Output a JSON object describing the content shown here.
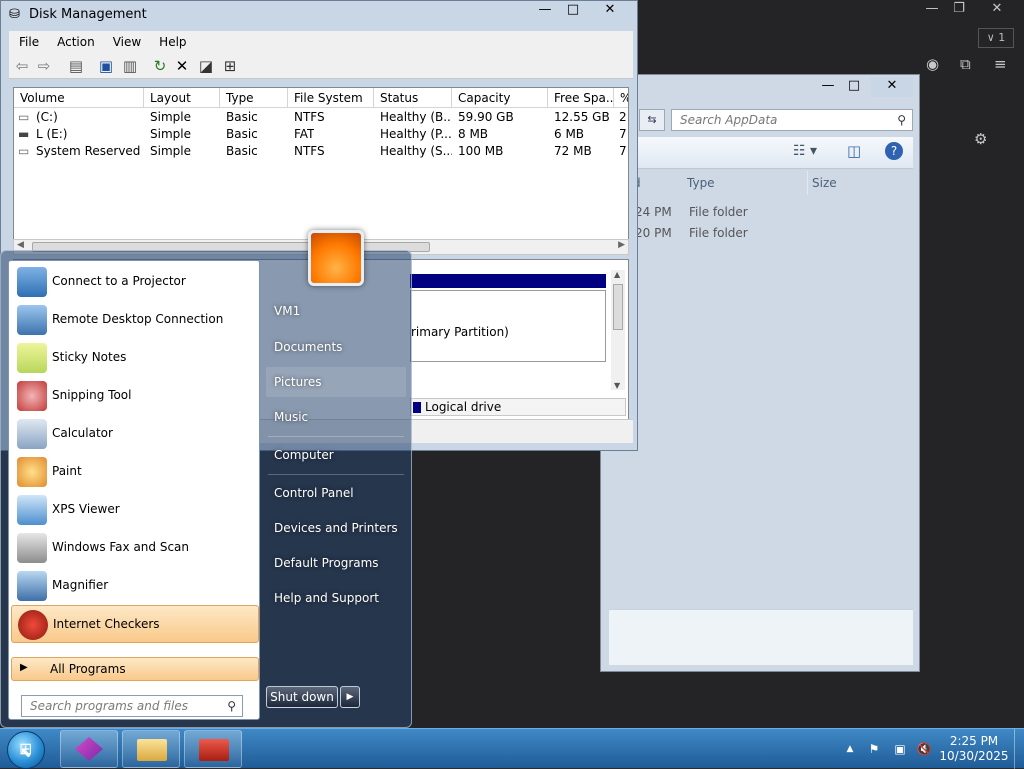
{
  "background_app": {
    "tab_counter": "1"
  },
  "explorer": {
    "search_placeholder": "Search AppData",
    "columns": [
      "Type",
      "Size"
    ],
    "rows": [
      {
        "date_fragment": "24 PM",
        "type": "File folder"
      },
      {
        "date_fragment": "20 PM",
        "type": "File folder"
      }
    ],
    "col_fragment": "d"
  },
  "disk_management": {
    "title": "Disk Management",
    "menu": [
      "File",
      "Action",
      "View",
      "Help"
    ],
    "columns": [
      "Volume",
      "Layout",
      "Type",
      "File System",
      "Status",
      "Capacity",
      "Free Spa...",
      "%"
    ],
    "volumes": [
      {
        "volume": "(C:)",
        "layout": "Simple",
        "type": "Basic",
        "fs": "NTFS",
        "status": "Healthy (B...",
        "capacity": "59.90 GB",
        "free": "12.55 GB",
        "pct": "2:"
      },
      {
        "volume": "L (E:)",
        "layout": "Simple",
        "type": "Basic",
        "fs": "FAT",
        "status": "Healthy (P...",
        "capacity": "8 MB",
        "free": "6 MB",
        "pct": "7!"
      },
      {
        "volume": "System Reserved",
        "layout": "Simple",
        "type": "Basic",
        "fs": "NTFS",
        "status": "Healthy (S...",
        "capacity": "100 MB",
        "free": "72 MB",
        "pct": "7:"
      }
    ],
    "partition_text": "rimary Partition)",
    "legend_label": "Logical drive",
    "accent_color": "#000080"
  },
  "start_menu": {
    "programs": [
      {
        "label": "Connect to a Projector",
        "icon": "projector-icon"
      },
      {
        "label": "Remote Desktop Connection",
        "icon": "remote-desktop-icon"
      },
      {
        "label": "Sticky Notes",
        "icon": "sticky-notes-icon"
      },
      {
        "label": "Snipping Tool",
        "icon": "snipping-tool-icon"
      },
      {
        "label": "Calculator",
        "icon": "calculator-icon"
      },
      {
        "label": "Paint",
        "icon": "paint-icon"
      },
      {
        "label": "XPS Viewer",
        "icon": "xps-viewer-icon"
      },
      {
        "label": "Windows Fax and Scan",
        "icon": "fax-scan-icon"
      },
      {
        "label": "Magnifier",
        "icon": "magnifier-icon"
      },
      {
        "label": "Internet Checkers",
        "icon": "checkers-icon"
      }
    ],
    "all_programs": "All Programs",
    "search_placeholder": "Search programs and files",
    "right_items": [
      "VM1",
      "Documents",
      "Pictures",
      "Music",
      "Computer",
      "Control Panel",
      "Devices and Printers",
      "Default Programs",
      "Help and Support"
    ],
    "shutdown": "Shut down"
  },
  "taskbar": {
    "time": "2:25 PM",
    "date": "10/30/2025"
  }
}
